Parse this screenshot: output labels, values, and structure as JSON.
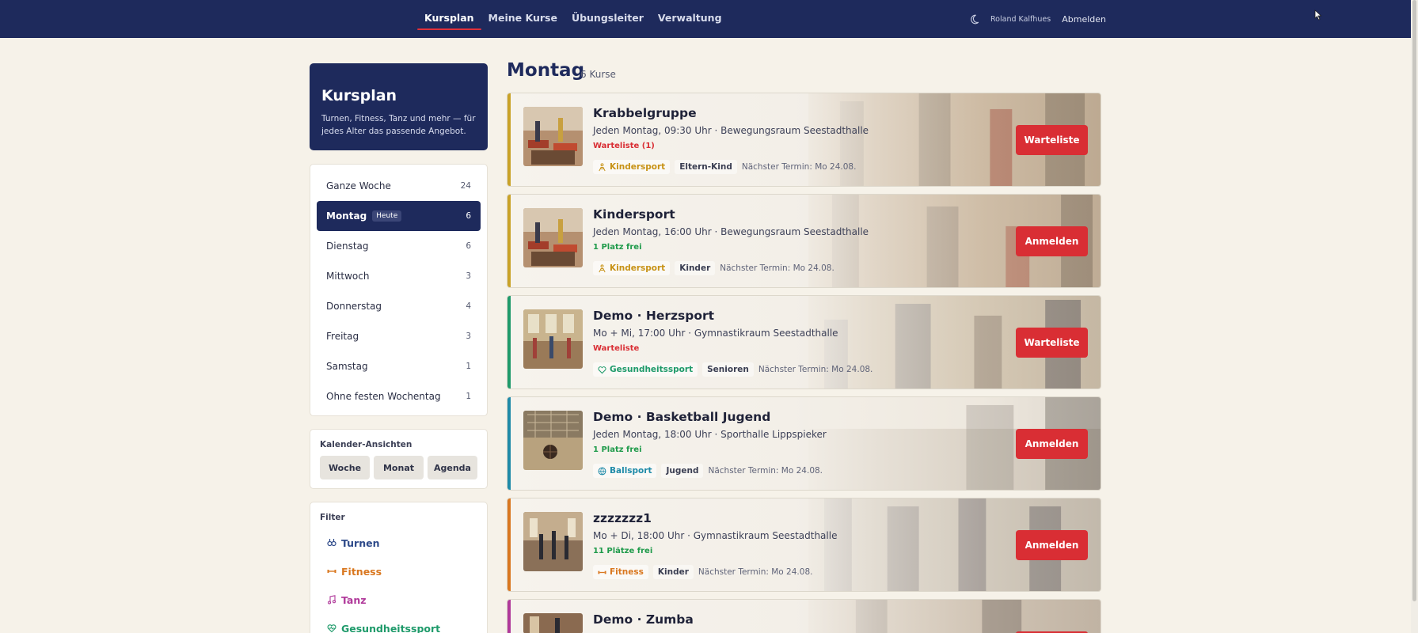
{
  "nav": {
    "items": [
      "Kursplan",
      "Meine Kurse",
      "Übungsleiter",
      "Verwaltung"
    ],
    "user": "Roland Kalfhues",
    "logout": "Abmelden"
  },
  "hero": {
    "title": "Kursplan",
    "text": "Turnen, Fitness, Tanz und mehr — für jedes Alter das passende Angebot."
  },
  "days": [
    {
      "label": "Ganze Woche",
      "count": "24"
    },
    {
      "label": "Montag",
      "badge": "Heute",
      "count": "6"
    },
    {
      "label": "Dienstag",
      "count": "6"
    },
    {
      "label": "Mittwoch",
      "count": "3"
    },
    {
      "label": "Donnerstag",
      "count": "4"
    },
    {
      "label": "Freitag",
      "count": "3"
    },
    {
      "label": "Samstag",
      "count": "1"
    },
    {
      "label": "Ohne festen Wochentag",
      "count": "1"
    }
  ],
  "calendar": {
    "label": "Kalender-Ansichten",
    "buttons": [
      "Woche",
      "Monat",
      "Agenda"
    ]
  },
  "filter": {
    "label": "Filter",
    "items": [
      {
        "label": "Turnen",
        "color": "#2e4a8a",
        "icon": "rings-icon"
      },
      {
        "label": "Fitness",
        "color": "#d9771f",
        "icon": "dumbbell-icon"
      },
      {
        "label": "Tanz",
        "color": "#b0399a",
        "icon": "music-note-icon"
      },
      {
        "label": "Gesundheitssport",
        "color": "#1e9a6a",
        "icon": "heart-pulse-icon"
      }
    ]
  },
  "main": {
    "title": "Montag",
    "count": "6 Kurse"
  },
  "courses": [
    {
      "title": "Krabbelgruppe",
      "subtitle": "Jeden Montag, 09:30 Uhr · Bewegungsraum Seestadthalle",
      "status": "Warteliste (1)",
      "status_color": "#d92e34",
      "category": "Kindersport",
      "category_color": "#c79216",
      "category_icon": "child-icon",
      "age": "Eltern-Kind",
      "next": "Nächster Termin: Mo 24.08.",
      "button": "Warteliste",
      "stripe": "#c9a227"
    },
    {
      "title": "Kindersport",
      "subtitle": "Jeden Montag, 16:00 Uhr · Bewegungsraum Seestadthalle",
      "status": "1 Platz frei",
      "status_color": "#1e9a4a",
      "category": "Kindersport",
      "category_color": "#c79216",
      "category_icon": "child-icon",
      "age": "Kinder",
      "next": "Nächster Termin: Mo 24.08.",
      "button": "Anmelden",
      "stripe": "#c9a227"
    },
    {
      "title": "Demo · Herzsport",
      "subtitle": "Mo + Mi, 17:00 Uhr · Gymnastikraum Seestadthalle",
      "status": "Warteliste",
      "status_color": "#d92e34",
      "category": "Gesundheitssport",
      "category_color": "#1e9a6a",
      "category_icon": "heart-pulse-icon",
      "age": "Senioren",
      "next": "Nächster Termin: Mo 24.08.",
      "button": "Warteliste",
      "stripe": "#1e9a6a"
    },
    {
      "title": "Demo · Basketball Jugend",
      "subtitle": "Jeden Montag, 18:00 Uhr · Sporthalle Lippspieker",
      "status": "1 Platz frei",
      "status_color": "#1e9a4a",
      "category": "Ballsport",
      "category_color": "#1e8aa8",
      "category_icon": "ball-icon",
      "age": "Jugend",
      "next": "Nächster Termin: Mo 24.08.",
      "button": "Anmelden",
      "stripe": "#1e8aa8"
    },
    {
      "title": "zzzzzzz1",
      "subtitle": "Mo + Di, 18:00 Uhr · Gymnastikraum Seestadthalle",
      "status": "11 Plätze frei",
      "status_color": "#1e9a4a",
      "category": "Fitness",
      "category_color": "#d9771f",
      "category_icon": "dumbbell-icon",
      "age": "Kinder",
      "next": "Nächster Termin: Mo 24.08.",
      "button": "Anmelden",
      "stripe": "#d9771f"
    },
    {
      "title": "Demo · Zumba",
      "subtitle": "",
      "status": "",
      "status_color": "#1e9a4a",
      "category": "",
      "category_color": "#b0399a",
      "category_icon": "music-note-icon",
      "age": "",
      "next": "",
      "button": "",
      "stripe": "#b0399a"
    }
  ]
}
